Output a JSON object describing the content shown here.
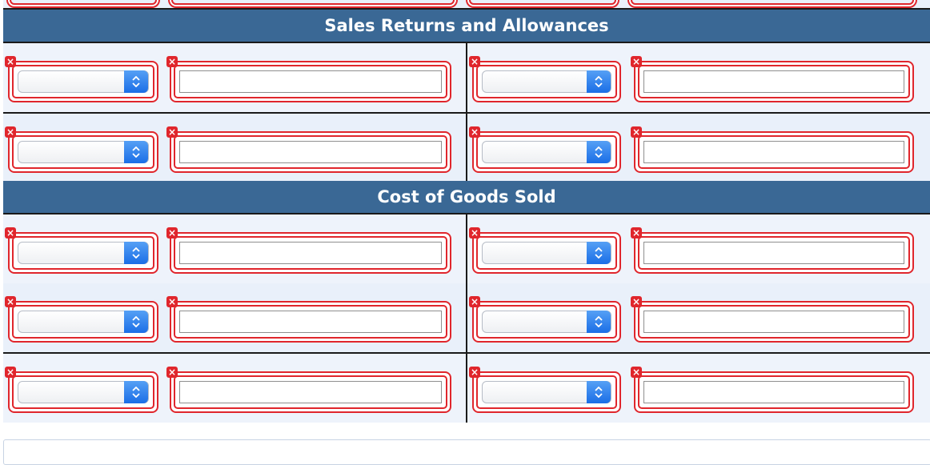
{
  "sections": [
    {
      "title": "Sales Returns and Allowances",
      "rows": [
        {
          "left": {
            "account": "",
            "amount": ""
          },
          "right": {
            "account": "",
            "amount": ""
          }
        },
        {
          "left": {
            "account": "",
            "amount": ""
          },
          "right": {
            "account": "",
            "amount": ""
          }
        }
      ]
    },
    {
      "title": "Cost of Goods Sold",
      "rows": [
        {
          "left": {
            "account": "",
            "amount": ""
          },
          "right": {
            "account": "",
            "amount": ""
          }
        },
        {
          "left": {
            "account": "",
            "amount": ""
          },
          "right": {
            "account": "",
            "amount": ""
          }
        },
        {
          "left": {
            "account": "",
            "amount": ""
          },
          "right": {
            "account": "",
            "amount": ""
          }
        }
      ]
    }
  ],
  "icons": {
    "error": "error-x-icon",
    "select_toggle": "chevron-up-down-icon"
  },
  "colors": {
    "header_bg": "#3a6895",
    "row_bg": "#e9f0fa",
    "error_border": "#e0262c",
    "select_accent": "#1b6ee6"
  }
}
